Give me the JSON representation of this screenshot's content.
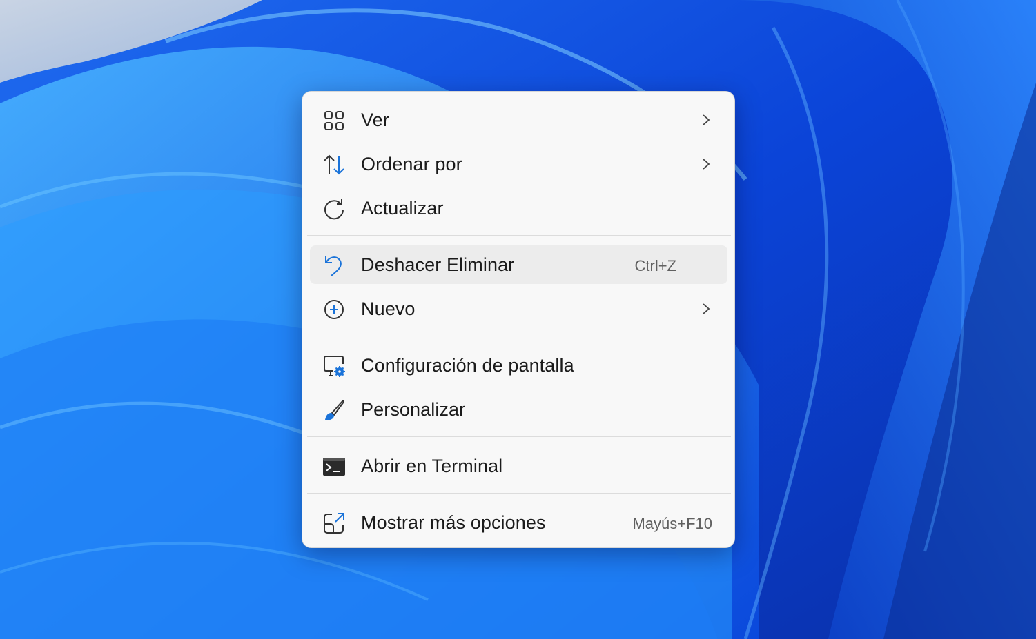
{
  "colors": {
    "accent": "#1a73d9",
    "menu_background": "#f8f8f8",
    "hover_background": "#ececec",
    "text": "#1b1b1b",
    "shortcut_text": "#606060"
  },
  "menu": {
    "items": [
      {
        "label": "Ver",
        "icon": "grid-view-icon",
        "submenu": true
      },
      {
        "label": "Ordenar por",
        "icon": "sort-arrows-icon",
        "submenu": true
      },
      {
        "label": "Actualizar",
        "icon": "refresh-icon",
        "submenu": false
      },
      {
        "label": "Deshacer Eliminar",
        "icon": "undo-icon",
        "shortcut": "Ctrl+Z",
        "hovered": true
      },
      {
        "label": "Nuevo",
        "icon": "add-circle-icon",
        "submenu": true
      },
      {
        "label": "Configuración de pantalla",
        "icon": "display-settings-icon"
      },
      {
        "label": "Personalizar",
        "icon": "brush-icon"
      },
      {
        "label": "Abrir en Terminal",
        "icon": "terminal-icon"
      },
      {
        "label": "Mostrar más opciones",
        "icon": "open-external-icon",
        "shortcut": "Mayús+F10"
      }
    ]
  }
}
